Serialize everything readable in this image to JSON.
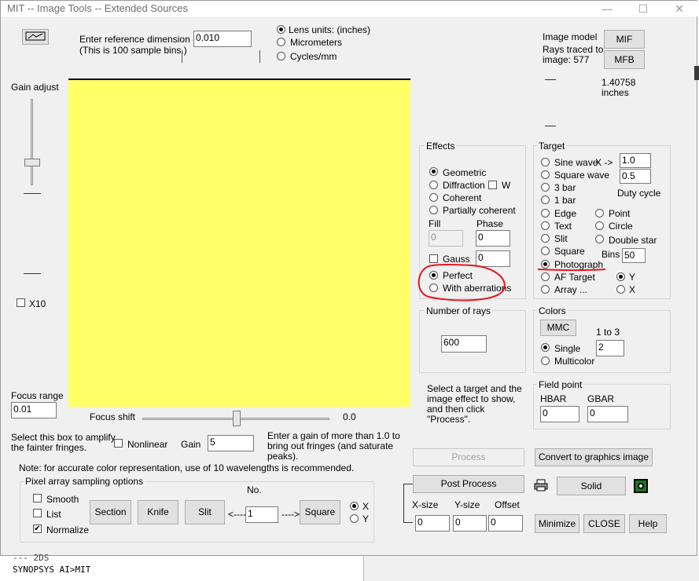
{
  "window": {
    "title": "MIT -- Image Tools -- Extended Sources",
    "minimize": "—",
    "maximize": "☐",
    "close": "✕"
  },
  "reference": {
    "label1": "Enter reference dimension --->",
    "label2": "(This is 100 sample bins.)",
    "value": "0.010"
  },
  "units": {
    "lens": "Lens units: (inches)",
    "micrometers": "Micrometers",
    "cycles": "Cycles/mm",
    "selected": "lens"
  },
  "image_model": {
    "label": "Image model",
    "rays_label1": "Rays traced to",
    "rays_label2": "image: 577",
    "mif": "MIF",
    "mfb": "MFB",
    "size_value": "1.40758",
    "size_unit": "inches"
  },
  "gain_adjust": {
    "label": "Gain adjust",
    "x10_label": "X10"
  },
  "effects": {
    "title": "Effects",
    "geometric": "Geometric",
    "diffraction": "Diffraction",
    "w_label": "W",
    "coherent": "Coherent",
    "partially_coherent": "Partially coherent",
    "fill_label": "Fill",
    "phase_label": "Phase",
    "fill_value": "0",
    "phase_value": "0",
    "gauss_label": "Gauss",
    "gauss_value": "0",
    "perfect": "Perfect",
    "with_aberrations": "With aberrations"
  },
  "target": {
    "title": "Target",
    "sine_wave": "Sine wave",
    "x_arrow": "X ->",
    "sine_value": "1.0",
    "square_wave": "Square wave",
    "square_value": "0.5",
    "three_bar": "3 bar",
    "one_bar": "1 bar",
    "duty_cycle": "Duty cycle",
    "edge": "Edge",
    "point": "Point",
    "text": "Text",
    "circle": "Circle",
    "slit": "Slit",
    "double_star": "Double star",
    "square": "Square",
    "bins_label": "Bins",
    "bins_value": "50",
    "photograph": "Photograph",
    "af_target": "AF Target",
    "y": "Y",
    "array": "Array ...",
    "x": "X"
  },
  "rays": {
    "title": "Number of rays",
    "value": "600"
  },
  "colors": {
    "title": "Colors",
    "mmc": "MMC",
    "range": "1 to 3",
    "single": "Single",
    "single_value": "2",
    "multicolor": "Multicolor"
  },
  "hint": {
    "line1": "Select a target and the",
    "line2": "image effect to show,",
    "line3": "and then click",
    "line4": "\"Process\"."
  },
  "field_point": {
    "title": "Field point",
    "hbar": "HBAR",
    "gbar": "GBAR",
    "hbar_value": "0",
    "gbar_value": "0"
  },
  "focus": {
    "range_label": "Focus range",
    "range_value": "0.01",
    "shift_label": "Focus shift",
    "shift_value": "0.0"
  },
  "amplify": {
    "line1": "Select this box to amplify",
    "line2": "the fainter fringes.",
    "nonlinear": "Nonlinear",
    "gain_label": "Gain",
    "gain_value": "5",
    "hint1": "Enter a gain of more than 1.0 to",
    "hint2": "bring out fringes (and saturate",
    "hint3": "peaks)."
  },
  "note": "Note: for accurate color representation, use of 10 wavelengths is recommended.",
  "pixel": {
    "title": "Pixel array sampling options",
    "smooth": "Smooth",
    "list": "List",
    "normalize": "Normalize",
    "section": "Section",
    "knife": "Knife",
    "slit": "Slit",
    "no_label": "No.",
    "left_arrow": "<----",
    "right_arrow": "---->",
    "no_value": "1",
    "square": "Square",
    "x": "X",
    "y": "Y"
  },
  "actions": {
    "process": "Process",
    "convert": "Convert to graphics image",
    "post_process": "Post Process",
    "solid": "Solid",
    "xsize": "X-size",
    "ysize": "Y-size",
    "offset": "Offset",
    "xsize_value": "0",
    "ysize_value": "0",
    "offset_value": "0",
    "minimize": "Minimize",
    "close": "CLOSE",
    "help": "Help"
  },
  "console": {
    "line1": "--- 2DS",
    "line2": "SYNOPSYS AI>MIT"
  },
  "colors_style": {
    "image_area": "#ffff66",
    "annotation": "#e8141a"
  }
}
